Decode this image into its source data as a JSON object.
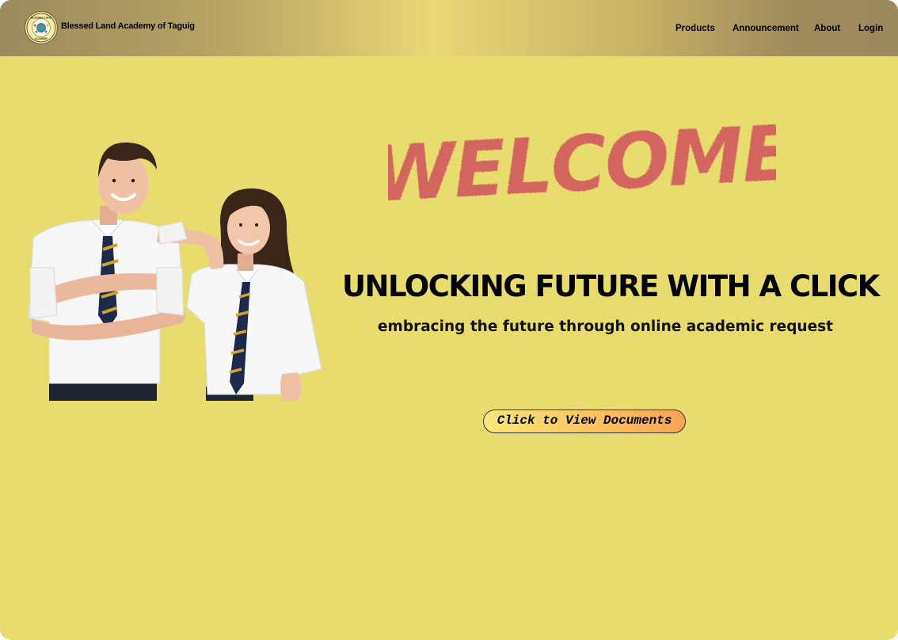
{
  "header": {
    "brand_name": "Blessed Land Academy of Taguig",
    "logo_text_top": "BLESSED LAND",
    "logo_text_bottom": "ACADEMY",
    "nav": [
      {
        "label": "Products"
      },
      {
        "label": "Announcement"
      },
      {
        "label": "About"
      },
      {
        "label": "Login"
      }
    ]
  },
  "hero": {
    "welcome": "WELCOME",
    "headline": "UNLOCKING FUTURE WITH A CLICK",
    "subheadline": "embracing the future through online academic request",
    "cta_label": "Click to View Documents",
    "image": "two-students-in-uniform"
  },
  "colors": {
    "background": "#e8dc6e",
    "welcome": "#d2665e",
    "cta_start": "#f7e87b",
    "cta_end": "#f7a357"
  }
}
